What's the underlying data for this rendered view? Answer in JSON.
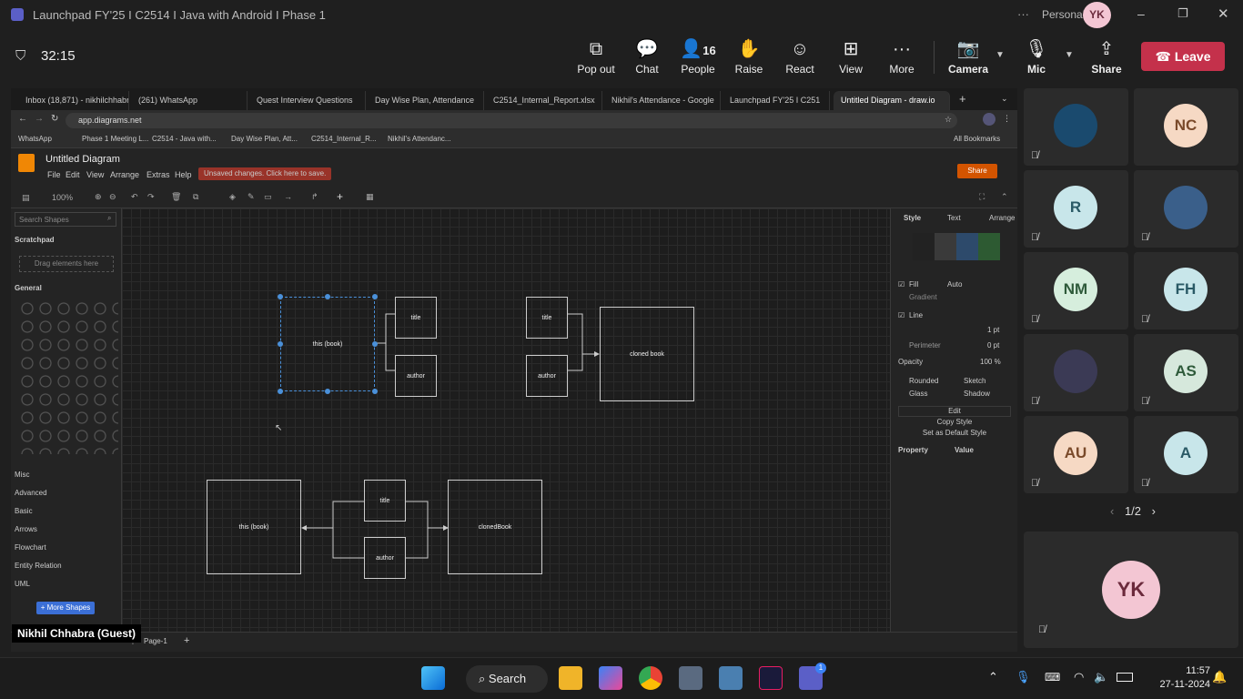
{
  "teams": {
    "app_title": "Launchpad FY'25 I C2514 I Java with Android I Phase 1",
    "account": "Personal",
    "account_initials": "YK",
    "timer": "32:15",
    "toolbar": [
      {
        "label": "Pop out",
        "icon": "popout-icon"
      },
      {
        "label": "Chat",
        "icon": "chat-icon"
      },
      {
        "label": "People",
        "icon": "people-icon",
        "count": "16"
      },
      {
        "label": "Raise",
        "icon": "hand-icon"
      },
      {
        "label": "React",
        "icon": "smile-icon"
      },
      {
        "label": "View",
        "icon": "grid-icon"
      },
      {
        "label": "More",
        "icon": "more-icon"
      },
      {
        "label": "Camera",
        "icon": "camera-off-icon"
      },
      {
        "label": "Mic",
        "icon": "mic-off-icon"
      },
      {
        "label": "Share",
        "icon": "share-icon"
      }
    ],
    "leave": "Leave"
  },
  "browser": {
    "tabs": [
      "Inbox (18,871) - nikhilchhabra",
      "(261) WhatsApp",
      "Quest Interview Questions",
      "Day Wise Plan, Attendance",
      "C2514_Internal_Report.xlsx",
      "Nikhil's Attendance - Google",
      "Launchpad FY'25 I C251",
      "Untitled Diagram - draw.io"
    ],
    "url": "app.diagrams.net",
    "bookmarks": [
      "WhatsApp",
      "Phase 1 Meeting L...",
      "C2514 - Java with...",
      "Day Wise Plan, Att...",
      "C2514_Internal_R...",
      "Nikhil's Attendanc..."
    ],
    "all_bookmarks": "All Bookmarks"
  },
  "drawio": {
    "title": "Untitled Diagram",
    "menus": [
      "File",
      "Edit",
      "View",
      "Arrange",
      "Extras",
      "Help"
    ],
    "unsaved": "Unsaved changes. Click here to save.",
    "share": "Share",
    "zoom": "100%",
    "search_placeholder": "Search Shapes",
    "scratchpad": "Scratchpad",
    "drag_here": "Drag elements here",
    "general": "General",
    "sections": [
      "Misc",
      "Advanced",
      "Basic",
      "Arrows",
      "Flowchart",
      "Entity Relation",
      "UML"
    ],
    "more_shapes": "+ More Shapes",
    "page": "Page-1",
    "panel": {
      "tabs": [
        "Style",
        "Text",
        "Arrange"
      ],
      "fill": "Fill",
      "fill_value": "Auto",
      "gradient": "Gradient",
      "line": "Line",
      "line_width": "1 pt",
      "perimeter": "Perimeter",
      "perimeter_value": "0 pt",
      "opacity": "Opacity",
      "opacity_value": "100 %",
      "rounded": "Rounded",
      "sketch": "Sketch",
      "glass": "Glass",
      "shadow": "Shadow",
      "edit": "Edit",
      "copy_style": "Copy Style",
      "default_style": "Set as Default Style",
      "property": "Property",
      "value": "Value"
    },
    "shapes": {
      "book1": "this (book)",
      "title1": "title",
      "author1": "author",
      "title2": "title",
      "author2": "author",
      "cloned1": "cloned book",
      "book2": "this (book)",
      "title3": "title",
      "author3": "author",
      "cloned2": "clonedBook"
    }
  },
  "participants": [
    {
      "initials": "",
      "color": "#1a4a6e"
    },
    {
      "initials": "NC",
      "color": "#f6d9c4"
    },
    {
      "initials": "R",
      "color": "#c8e6ea"
    },
    {
      "initials": "",
      "color": "#3a5f8a"
    },
    {
      "initials": "NM",
      "color": "#d6eedd"
    },
    {
      "initials": "FH",
      "color": "#c8e6ea"
    },
    {
      "initials": "",
      "color": "#3b3a55"
    },
    {
      "initials": "AS",
      "color": "#d6e8dc"
    },
    {
      "initials": "AU",
      "color": "#f6d9c4"
    },
    {
      "initials": "A",
      "color": "#c8e6ea"
    }
  ],
  "pager": "1/2",
  "self": {
    "initials": "YK",
    "name": "Nikhil Chhabra (Guest)"
  },
  "taskbar": {
    "search": "Search",
    "time": "11:57",
    "date": "27-11-2024",
    "teams_badge": "1"
  }
}
